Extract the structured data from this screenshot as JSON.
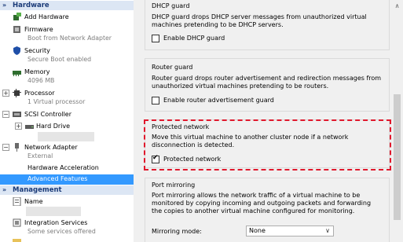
{
  "tree": {
    "hardware_header": "Hardware",
    "management_header": "Management",
    "items": {
      "add_hardware": "Add Hardware",
      "firmware": "Firmware",
      "firmware_sub": "Boot from Network Adapter",
      "security": "Security",
      "security_sub": "Secure Boot enabled",
      "memory": "Memory",
      "memory_sub": "4096 MB",
      "processor": "Processor",
      "processor_sub": "1 Virtual processor",
      "scsi": "SCSI Controller",
      "hard_drive": "Hard Drive",
      "network_adapter": "Network Adapter",
      "network_adapter_sub": "External",
      "hw_accel": "Hardware Acceleration",
      "adv_features": "Advanced Features",
      "name": "Name",
      "integration": "Integration Services",
      "integration_sub": "Some services offered"
    },
    "chevron_glyph": "»",
    "expand_glyph": "⊞",
    "collapse_glyph": "⊟"
  },
  "content": {
    "dhcp": {
      "title": "DHCP guard",
      "desc": "DHCP guard drops DHCP server messages from unauthorized virtual machines pretending to be DHCP servers.",
      "checkbox": "Enable DHCP guard",
      "checked": false
    },
    "router": {
      "title": "Router guard",
      "desc": "Router guard drops router advertisement and redirection messages from unauthorized virtual machines pretending to be routers.",
      "checkbox": "Enable router advertisement guard",
      "checked": false
    },
    "protected": {
      "title": "Protected network",
      "desc": "Move this virtual machine to another cluster node if a network disconnection is detected.",
      "checkbox": "Protected network",
      "checked": true,
      "check_glyph": "✔"
    },
    "mirroring": {
      "title": "Port mirroring",
      "desc": "Port mirroring allows the network traffic of a virtual machine to be monitored by copying incoming and outgoing packets and forwarding the copies to another virtual machine configured for monitoring.",
      "mode_label": "Mirroring mode:",
      "mode_value": "None",
      "dropdown_glyph": "∨"
    }
  },
  "scroll": {
    "up_glyph": "∧"
  },
  "colors": {
    "accent": "#3399ff",
    "highlight": "#e0182c",
    "header_bg": "#dce6f4",
    "header_text": "#1a3a78"
  }
}
